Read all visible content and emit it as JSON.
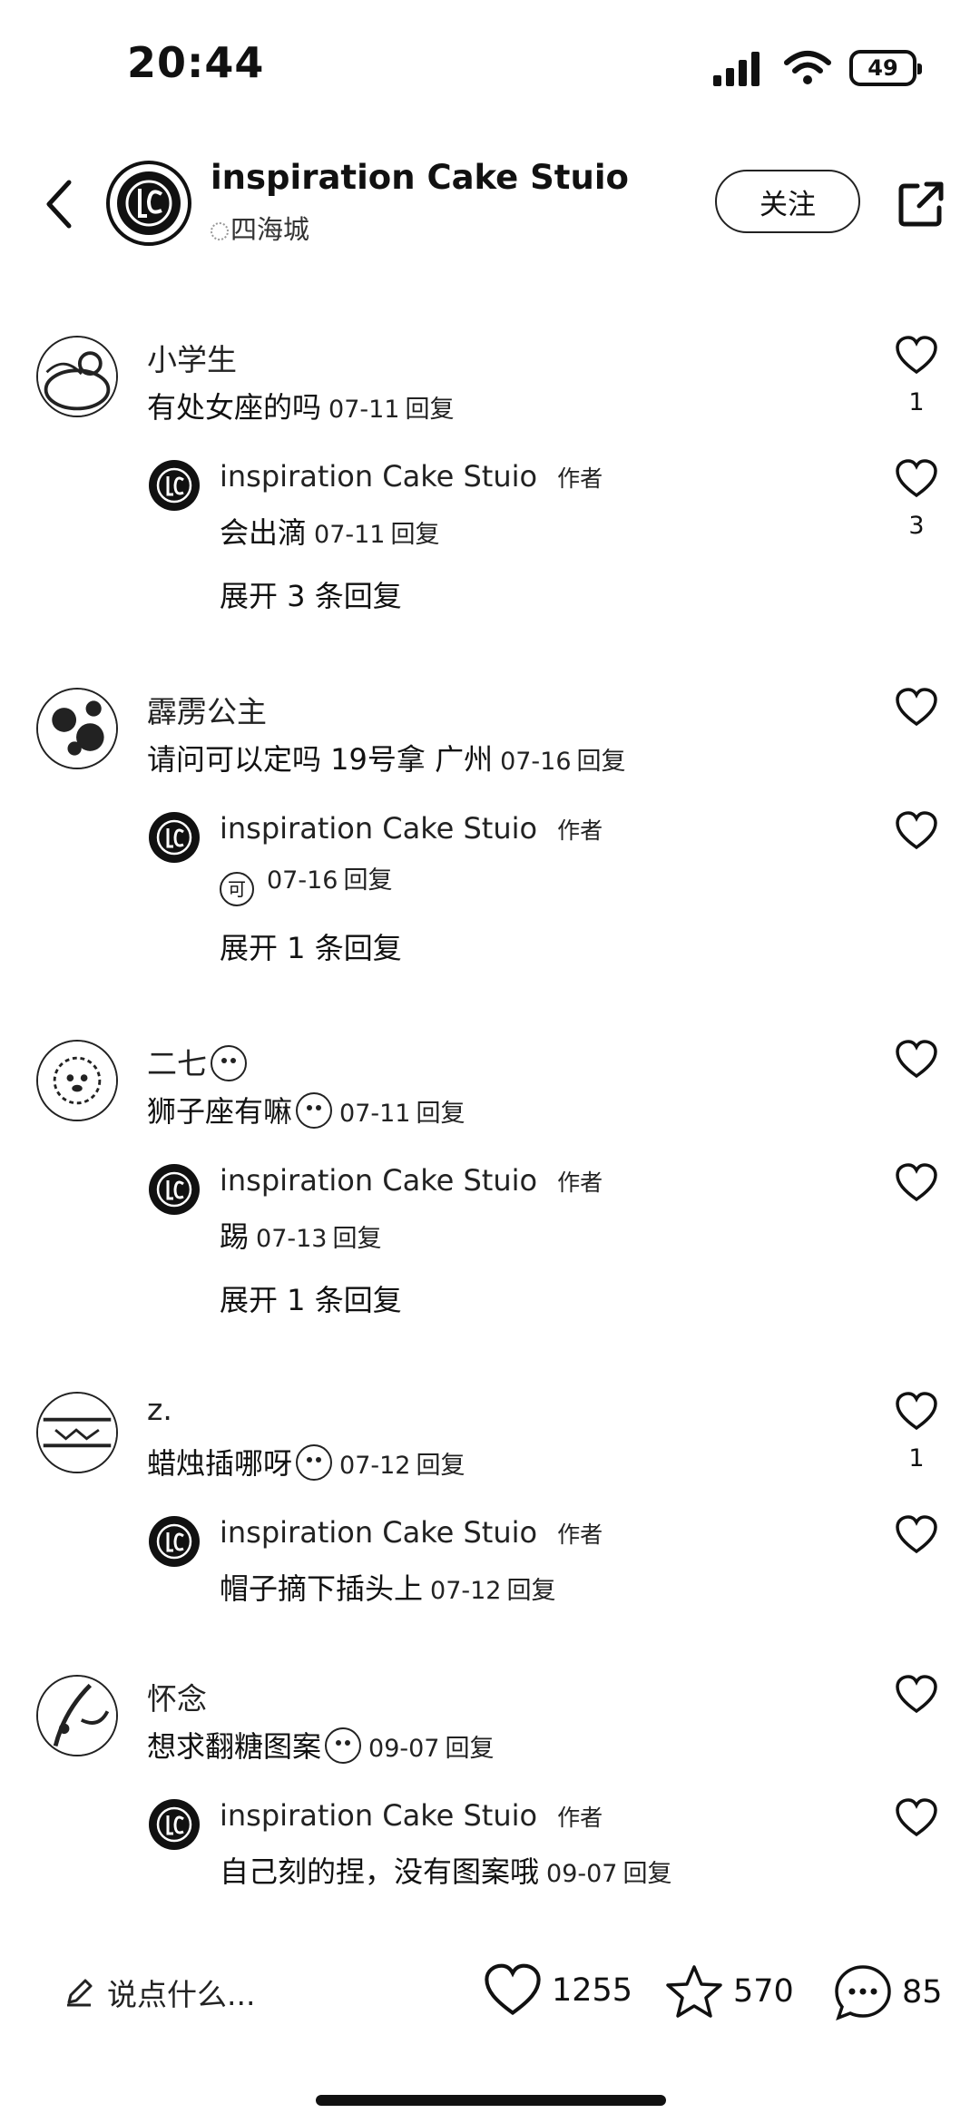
{
  "status": {
    "time": "20:44",
    "battery": "49"
  },
  "header": {
    "name": "inspiration Cake Stuio",
    "location": "四海城",
    "follow_label": "关注"
  },
  "comments": [
    {
      "name": "小学生",
      "text": "有处女座的吗",
      "date": "07-11",
      "reply": "回复",
      "likes": "1",
      "sub": {
        "name": "inspiration Cake Stuio",
        "badge": "作者",
        "text": "会出滴",
        "date": "07-11",
        "reply": "回复",
        "likes": "3"
      },
      "expand": "展开 3 条回复"
    },
    {
      "name": "霹雳公主",
      "text": "请问可以定吗 19号拿 广州",
      "date": "07-16",
      "reply": "回复",
      "likes": "",
      "sub": {
        "name": "inspiration Cake Stuio",
        "badge": "作者",
        "text": "",
        "sticker": "可",
        "date": "07-16",
        "reply": "回复",
        "likes": ""
      },
      "expand": "展开 1 条回复"
    },
    {
      "name": "二七",
      "text": "狮子座有嘛",
      "date": "07-11",
      "reply": "回复",
      "likes": "",
      "sub": {
        "name": "inspiration Cake Stuio",
        "badge": "作者",
        "text": "踢",
        "date": "07-13",
        "reply": "回复",
        "likes": ""
      },
      "expand": "展开 1 条回复"
    },
    {
      "name": "z.",
      "text": "蜡烛插哪呀",
      "date": "07-12",
      "reply": "回复",
      "likes": "1",
      "sub": {
        "name": "inspiration Cake Stuio",
        "badge": "作者",
        "text": "帽子摘下插头上",
        "date": "07-12",
        "reply": "回复",
        "likes": ""
      }
    },
    {
      "name": "怀念",
      "text": "想求翻糖图案",
      "date": "09-07",
      "reply": "回复",
      "likes": "",
      "sub": {
        "name": "inspiration Cake Stuio",
        "badge": "作者",
        "text": "自己刻的捏，没有图案哦",
        "date": "09-07",
        "reply": "回复",
        "likes": ""
      }
    }
  ],
  "bottom": {
    "placeholder": "说点什么...",
    "likes": "1255",
    "favorites": "570",
    "comments": "85"
  }
}
